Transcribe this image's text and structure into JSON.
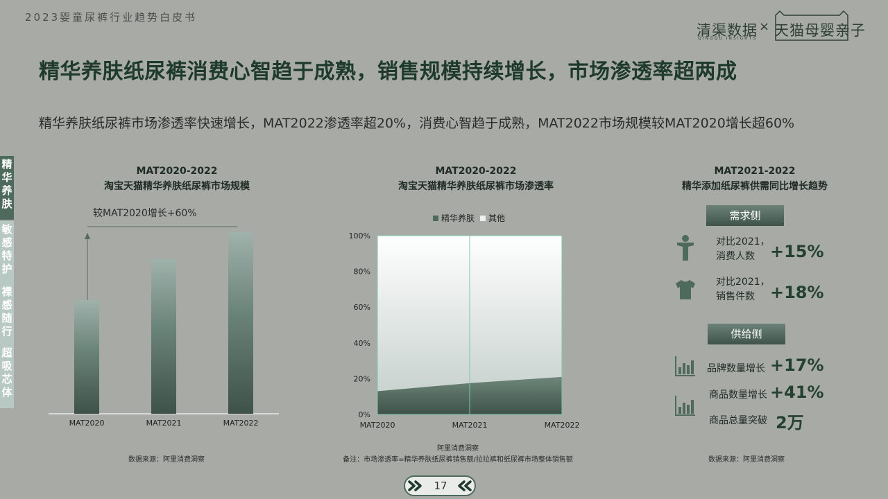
{
  "header": {
    "report_title": "2023婴童尿裤行业趋势白皮书",
    "logo_left": "清渠数据",
    "logo_left_sub": "QINGQU INSIGHTS",
    "logo_sep": "×",
    "logo_right": "天猫母婴亲子"
  },
  "main_title": "精华养肤纸尿裤消费心智趋于成熟，销售规模持续增长，市场渗透率超两成",
  "subtitle": "精华养肤纸尿裤市场渗透率快速增长，MAT2022渗透率超20%，消费心智趋于成熟，MAT2022市场规模较MAT2020增长超60%",
  "side_tabs": [
    {
      "label": "精华养肤",
      "active": true
    },
    {
      "label": "敏感特护",
      "active": false
    },
    {
      "label": "裸感随行",
      "active": false
    },
    {
      "label": "超吸芯体",
      "active": false
    }
  ],
  "chart1": {
    "head_line1": "MAT2020-2022",
    "head_line2": "淘宝天猫精华养肤纸尿裤市场规模",
    "annotation": "较MAT2020增长+60%",
    "source": "数据来源：阿里消费洞察"
  },
  "chart2": {
    "head_line1": "MAT2020-2022",
    "head_line2": "淘宝天猫精华养肤纸尿裤市场渗透率",
    "source_line1": "阿里消费洞察",
    "source_line2": "备注：市场渗透率=精华养肤纸尿裤销售额/拉拉裤和纸尿裤市场整体销售额"
  },
  "chart_data": [
    {
      "type": "bar",
      "categories": [
        "MAT2020",
        "MAT2021",
        "MAT2022"
      ],
      "values": [
        100,
        136,
        160
      ],
      "ylim": [
        0,
        160
      ],
      "grid": false,
      "legend": "none"
    },
    {
      "type": "area",
      "x": [
        "MAT2020",
        "MAT2021",
        "MAT2022"
      ],
      "y_ticks": [
        "0%",
        "20%",
        "40%",
        "60%",
        "80%",
        "100%"
      ],
      "ylim": [
        0,
        100
      ],
      "series": [
        {
          "name": "精华养肤",
          "values": [
            13,
            17.5,
            21
          ],
          "color": "#4e6a5d"
        },
        {
          "name": "其他",
          "values": [
            87,
            82.5,
            79
          ],
          "color": "#eef1ef"
        }
      ],
      "legend": "top"
    }
  ],
  "right_panel": {
    "head_line1": "MAT2021-2022",
    "head_line2": "精华添加纸尿裤供需同比增长趋势",
    "demand_pill": "需求侧",
    "demand": [
      {
        "label_line1": "对比2021，",
        "label_line2": "消费人数",
        "value": "+15%",
        "icon": "person-icon"
      },
      {
        "label_line1": "对比2021，",
        "label_line2": "销售件数",
        "value": "+18%",
        "icon": "tshirt-icon"
      }
    ],
    "supply_pill": "供给侧",
    "supply": [
      {
        "label": "品牌数量增长",
        "value": "+17%",
        "icon": "bar-chart-icon"
      },
      {
        "label": "商品数量增长",
        "value": "+41%",
        "icon": "bar-chart-icon"
      },
      {
        "label": "商品总量突破",
        "value": "2万"
      }
    ],
    "source": "数据来源：阿里消费洞察"
  },
  "footer": {
    "page_number": "17"
  }
}
